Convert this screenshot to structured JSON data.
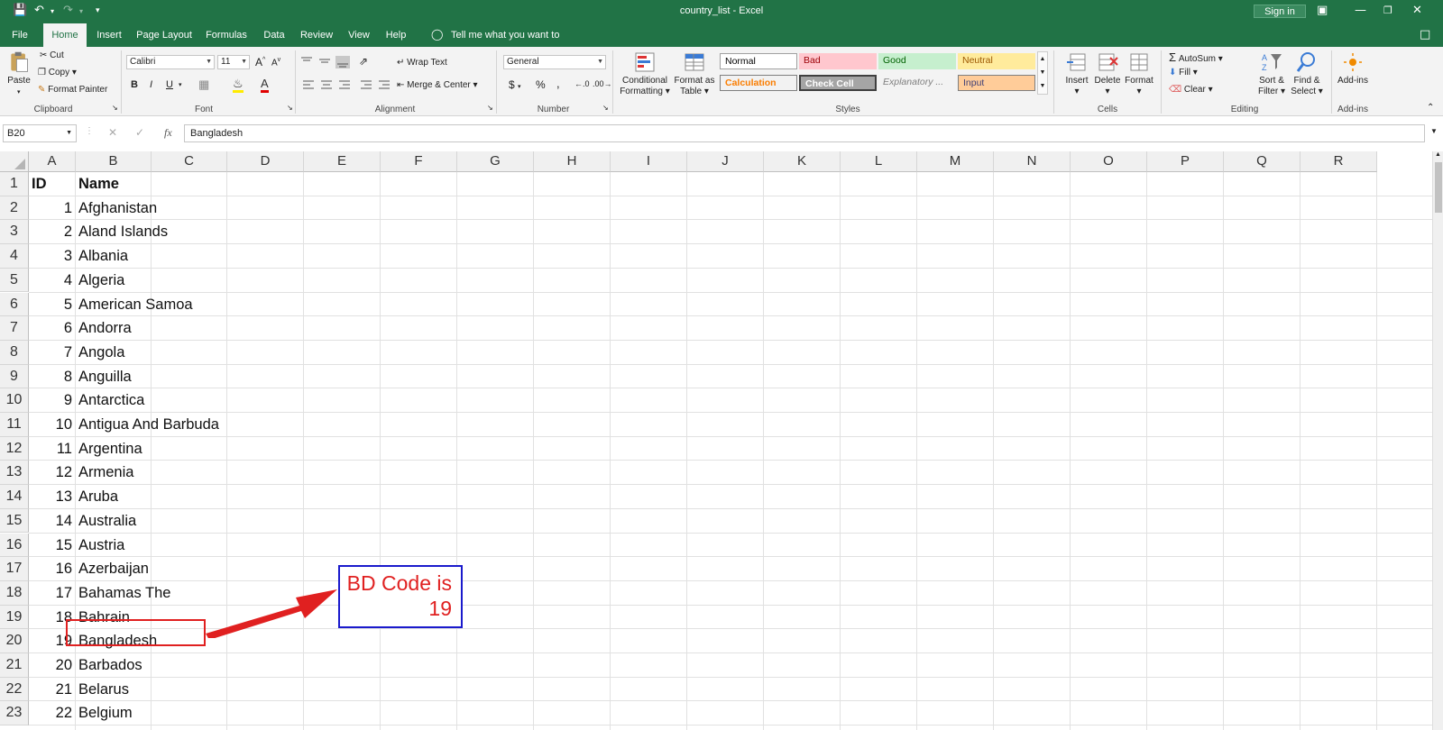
{
  "window": {
    "title": "country_list  -  Excel",
    "sign_in": "Sign in"
  },
  "tabs": [
    "File",
    "Home",
    "Insert",
    "Page Layout",
    "Formulas",
    "Data",
    "Review",
    "View",
    "Help"
  ],
  "tell_me": "Tell me what you want to do",
  "ribbon": {
    "clipboard": {
      "paste": "Paste",
      "cut": "Cut",
      "copy": "Copy",
      "format_painter": "Format Painter",
      "label": "Clipboard"
    },
    "font": {
      "name": "Calibri",
      "size": "11",
      "bold": "B",
      "italic": "I",
      "underline": "U",
      "label": "Font"
    },
    "alignment": {
      "wrap": "Wrap Text",
      "merge": "Merge & Center",
      "label": "Alignment"
    },
    "number": {
      "format": "General",
      "label": "Number",
      "currency": "$",
      "percent": "%",
      "comma": ","
    },
    "styles": {
      "cond_fmt_1": "Conditional",
      "cond_fmt_2": "Formatting",
      "fmt_table_1": "Format as",
      "fmt_table_2": "Table",
      "normal": "Normal",
      "bad": "Bad",
      "good": "Good",
      "neutral": "Neutral",
      "calculation": "Calculation",
      "check_cell": "Check Cell",
      "explanatory": "Explanatory ...",
      "input": "Input",
      "label": "Styles"
    },
    "cells": {
      "insert": "Insert",
      "delete": "Delete",
      "format": "Format",
      "label": "Cells"
    },
    "editing": {
      "autosum": "AutoSum",
      "fill": "Fill",
      "clear": "Clear",
      "sort_1": "Sort &",
      "sort_2": "Filter",
      "find_1": "Find &",
      "find_2": "Select",
      "label": "Editing"
    },
    "addins": {
      "addins": "Add-ins",
      "label": "Add-ins"
    }
  },
  "formula_bar": {
    "name_box": "B20",
    "fx": "fx",
    "value": "Bangladesh"
  },
  "columns": [
    "A",
    "B",
    "C",
    "D",
    "E",
    "F",
    "G",
    "H",
    "I",
    "J",
    "K",
    "L",
    "M",
    "N",
    "O",
    "P",
    "Q",
    "R"
  ],
  "rows": [
    {
      "n": "1",
      "id": "ID",
      "name": "Name",
      "header": true
    },
    {
      "n": "2",
      "id": "1",
      "name": "Afghanistan"
    },
    {
      "n": "3",
      "id": "2",
      "name": "Aland Islands"
    },
    {
      "n": "4",
      "id": "3",
      "name": "Albania"
    },
    {
      "n": "5",
      "id": "4",
      "name": "Algeria"
    },
    {
      "n": "6",
      "id": "5",
      "name": "American Samoa"
    },
    {
      "n": "7",
      "id": "6",
      "name": "Andorra"
    },
    {
      "n": "8",
      "id": "7",
      "name": "Angola"
    },
    {
      "n": "9",
      "id": "8",
      "name": "Anguilla"
    },
    {
      "n": "10",
      "id": "9",
      "name": "Antarctica"
    },
    {
      "n": "11",
      "id": "10",
      "name": "Antigua And Barbuda"
    },
    {
      "n": "12",
      "id": "11",
      "name": "Argentina"
    },
    {
      "n": "13",
      "id": "12",
      "name": "Armenia"
    },
    {
      "n": "14",
      "id": "13",
      "name": "Aruba"
    },
    {
      "n": "15",
      "id": "14",
      "name": "Australia"
    },
    {
      "n": "16",
      "id": "15",
      "name": "Austria"
    },
    {
      "n": "17",
      "id": "16",
      "name": "Azerbaijan"
    },
    {
      "n": "18",
      "id": "17",
      "name": "Bahamas The"
    },
    {
      "n": "19",
      "id": "18",
      "name": "Bahrain"
    },
    {
      "n": "20",
      "id": "19",
      "name": "Bangladesh"
    },
    {
      "n": "21",
      "id": "20",
      "name": "Barbados"
    },
    {
      "n": "22",
      "id": "21",
      "name": "Belarus"
    },
    {
      "n": "23",
      "id": "22",
      "name": "Belgium"
    }
  ],
  "callout": {
    "line1": "BD Code is",
    "line2": "19"
  },
  "colors": {
    "accent": "#217346",
    "highlight": "#e02020",
    "callout_border": "#1a1acc"
  }
}
